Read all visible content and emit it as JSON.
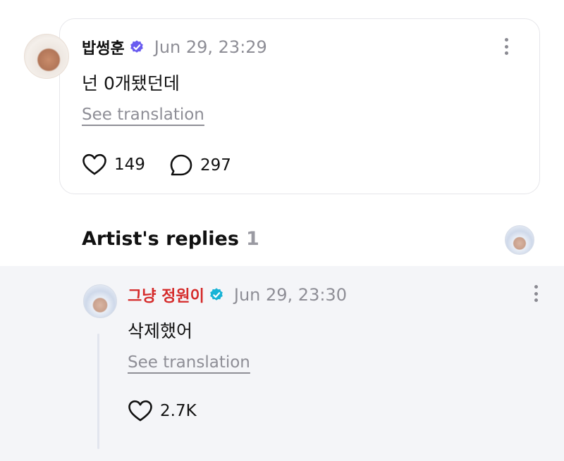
{
  "post": {
    "username": "밥썽훈",
    "timestamp": "Jun 29, 23:29",
    "text": "넌 0개됐던데",
    "translate_label": "See translation",
    "likes": "149",
    "comments": "297"
  },
  "artist_replies": {
    "title": "Artist's replies",
    "count": "1"
  },
  "reply": {
    "username": "그냥 정원이",
    "timestamp": "Jun 29, 23:30",
    "text": "삭제했어",
    "translate_label": "See translation",
    "likes": "2.7K"
  },
  "colors": {
    "artist_name": "#d52a2a",
    "verified_badge_fan": "#6a5cf0",
    "verified_badge_artist": "#18b3d6",
    "muted_text": "#8e8e96",
    "reply_background": "#f4f5f8"
  },
  "icons": [
    "verified-badge-icon",
    "heart-icon",
    "comment-icon",
    "more-vertical-icon",
    "avatar"
  ]
}
